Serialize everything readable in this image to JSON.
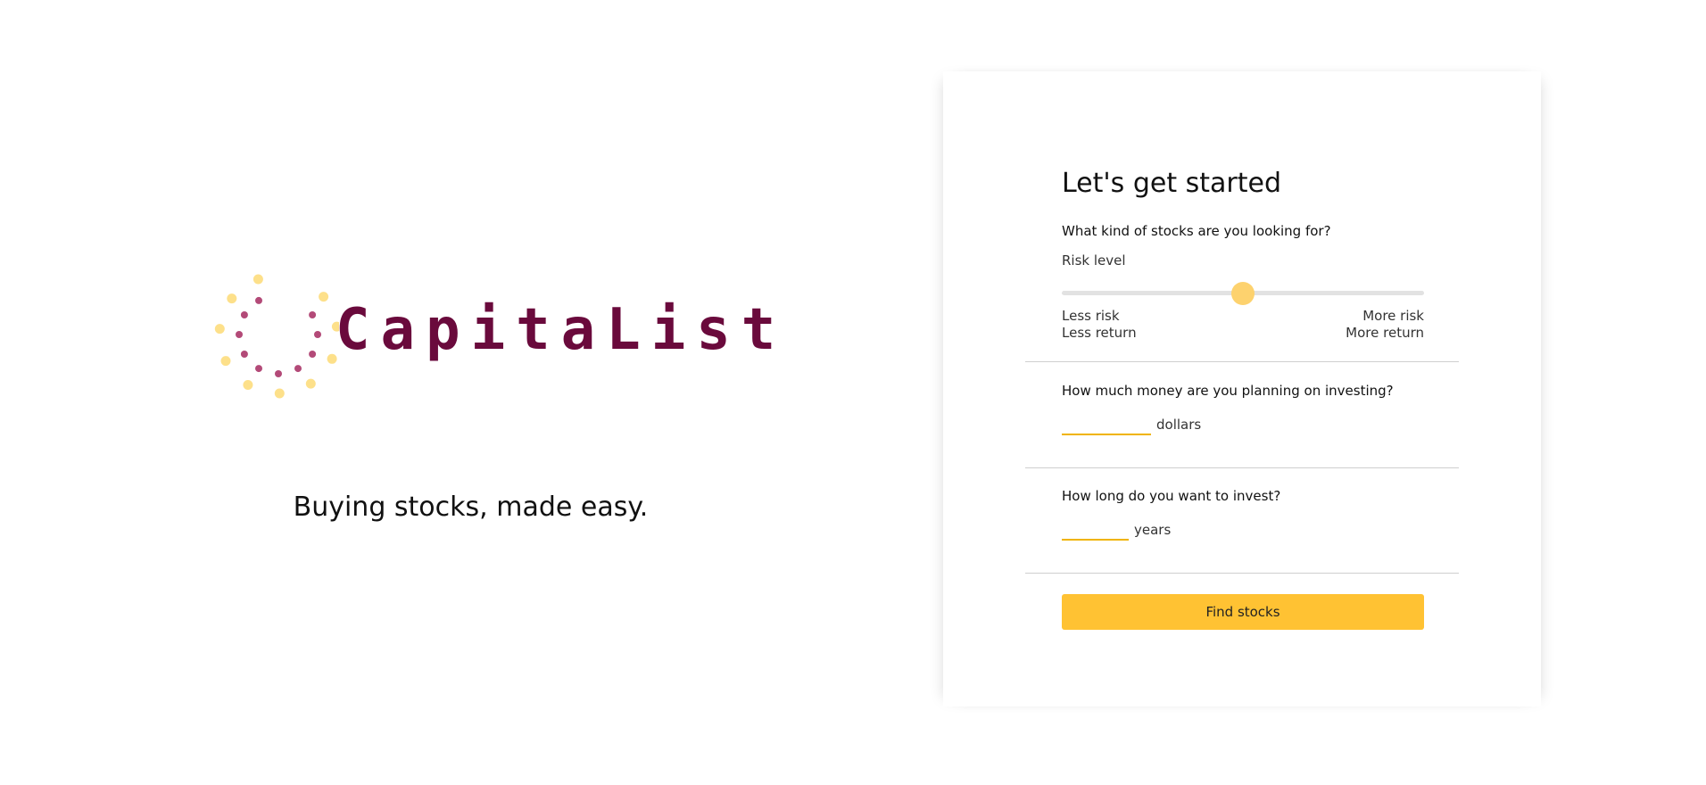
{
  "brand": {
    "name": "CapitaList",
    "tagline": "Buying stocks, made easy.",
    "primary_color": "#6a0a3c",
    "accent_color": "#ffc233",
    "dot_colors": [
      "#fde08a",
      "#b34a78"
    ],
    "icon": "dotted-circle-logo-icon"
  },
  "form": {
    "title": "Let's get started",
    "risk": {
      "question": "What kind of stocks are you looking for?",
      "label": "Risk level",
      "value": 0.5,
      "less_risk": "Less risk",
      "less_return": "Less return",
      "more_risk": "More risk",
      "more_return": "More return"
    },
    "money": {
      "question": "How much money are you planning on investing?",
      "value": "",
      "unit": "dollars"
    },
    "duration": {
      "question": "How long do you want to invest?",
      "value": "",
      "unit": "years"
    },
    "submit_label": "Find stocks"
  }
}
